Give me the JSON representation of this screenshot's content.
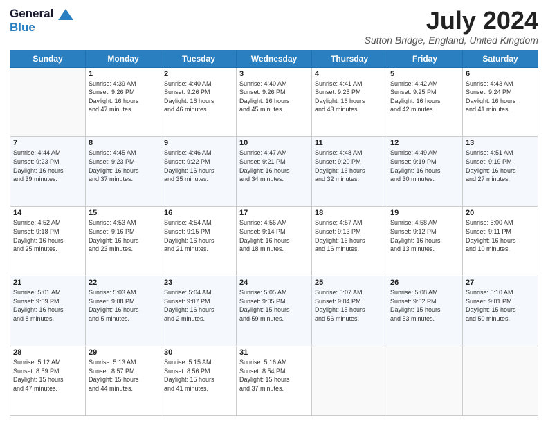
{
  "logo": {
    "line1": "General",
    "line2": "Blue"
  },
  "title": "July 2024",
  "subtitle": "Sutton Bridge, England, United Kingdom",
  "weekdays": [
    "Sunday",
    "Monday",
    "Tuesday",
    "Wednesday",
    "Thursday",
    "Friday",
    "Saturday"
  ],
  "weeks": [
    [
      {
        "day": "",
        "info": ""
      },
      {
        "day": "1",
        "info": "Sunrise: 4:39 AM\nSunset: 9:26 PM\nDaylight: 16 hours\nand 47 minutes."
      },
      {
        "day": "2",
        "info": "Sunrise: 4:40 AM\nSunset: 9:26 PM\nDaylight: 16 hours\nand 46 minutes."
      },
      {
        "day": "3",
        "info": "Sunrise: 4:40 AM\nSunset: 9:26 PM\nDaylight: 16 hours\nand 45 minutes."
      },
      {
        "day": "4",
        "info": "Sunrise: 4:41 AM\nSunset: 9:25 PM\nDaylight: 16 hours\nand 43 minutes."
      },
      {
        "day": "5",
        "info": "Sunrise: 4:42 AM\nSunset: 9:25 PM\nDaylight: 16 hours\nand 42 minutes."
      },
      {
        "day": "6",
        "info": "Sunrise: 4:43 AM\nSunset: 9:24 PM\nDaylight: 16 hours\nand 41 minutes."
      }
    ],
    [
      {
        "day": "7",
        "info": "Sunrise: 4:44 AM\nSunset: 9:23 PM\nDaylight: 16 hours\nand 39 minutes."
      },
      {
        "day": "8",
        "info": "Sunrise: 4:45 AM\nSunset: 9:23 PM\nDaylight: 16 hours\nand 37 minutes."
      },
      {
        "day": "9",
        "info": "Sunrise: 4:46 AM\nSunset: 9:22 PM\nDaylight: 16 hours\nand 35 minutes."
      },
      {
        "day": "10",
        "info": "Sunrise: 4:47 AM\nSunset: 9:21 PM\nDaylight: 16 hours\nand 34 minutes."
      },
      {
        "day": "11",
        "info": "Sunrise: 4:48 AM\nSunset: 9:20 PM\nDaylight: 16 hours\nand 32 minutes."
      },
      {
        "day": "12",
        "info": "Sunrise: 4:49 AM\nSunset: 9:19 PM\nDaylight: 16 hours\nand 30 minutes."
      },
      {
        "day": "13",
        "info": "Sunrise: 4:51 AM\nSunset: 9:19 PM\nDaylight: 16 hours\nand 27 minutes."
      }
    ],
    [
      {
        "day": "14",
        "info": "Sunrise: 4:52 AM\nSunset: 9:18 PM\nDaylight: 16 hours\nand 25 minutes."
      },
      {
        "day": "15",
        "info": "Sunrise: 4:53 AM\nSunset: 9:16 PM\nDaylight: 16 hours\nand 23 minutes."
      },
      {
        "day": "16",
        "info": "Sunrise: 4:54 AM\nSunset: 9:15 PM\nDaylight: 16 hours\nand 21 minutes."
      },
      {
        "day": "17",
        "info": "Sunrise: 4:56 AM\nSunset: 9:14 PM\nDaylight: 16 hours\nand 18 minutes."
      },
      {
        "day": "18",
        "info": "Sunrise: 4:57 AM\nSunset: 9:13 PM\nDaylight: 16 hours\nand 16 minutes."
      },
      {
        "day": "19",
        "info": "Sunrise: 4:58 AM\nSunset: 9:12 PM\nDaylight: 16 hours\nand 13 minutes."
      },
      {
        "day": "20",
        "info": "Sunrise: 5:00 AM\nSunset: 9:11 PM\nDaylight: 16 hours\nand 10 minutes."
      }
    ],
    [
      {
        "day": "21",
        "info": "Sunrise: 5:01 AM\nSunset: 9:09 PM\nDaylight: 16 hours\nand 8 minutes."
      },
      {
        "day": "22",
        "info": "Sunrise: 5:03 AM\nSunset: 9:08 PM\nDaylight: 16 hours\nand 5 minutes."
      },
      {
        "day": "23",
        "info": "Sunrise: 5:04 AM\nSunset: 9:07 PM\nDaylight: 16 hours\nand 2 minutes."
      },
      {
        "day": "24",
        "info": "Sunrise: 5:05 AM\nSunset: 9:05 PM\nDaylight: 15 hours\nand 59 minutes."
      },
      {
        "day": "25",
        "info": "Sunrise: 5:07 AM\nSunset: 9:04 PM\nDaylight: 15 hours\nand 56 minutes."
      },
      {
        "day": "26",
        "info": "Sunrise: 5:08 AM\nSunset: 9:02 PM\nDaylight: 15 hours\nand 53 minutes."
      },
      {
        "day": "27",
        "info": "Sunrise: 5:10 AM\nSunset: 9:01 PM\nDaylight: 15 hours\nand 50 minutes."
      }
    ],
    [
      {
        "day": "28",
        "info": "Sunrise: 5:12 AM\nSunset: 8:59 PM\nDaylight: 15 hours\nand 47 minutes."
      },
      {
        "day": "29",
        "info": "Sunrise: 5:13 AM\nSunset: 8:57 PM\nDaylight: 15 hours\nand 44 minutes."
      },
      {
        "day": "30",
        "info": "Sunrise: 5:15 AM\nSunset: 8:56 PM\nDaylight: 15 hours\nand 41 minutes."
      },
      {
        "day": "31",
        "info": "Sunrise: 5:16 AM\nSunset: 8:54 PM\nDaylight: 15 hours\nand 37 minutes."
      },
      {
        "day": "",
        "info": ""
      },
      {
        "day": "",
        "info": ""
      },
      {
        "day": "",
        "info": ""
      }
    ]
  ]
}
